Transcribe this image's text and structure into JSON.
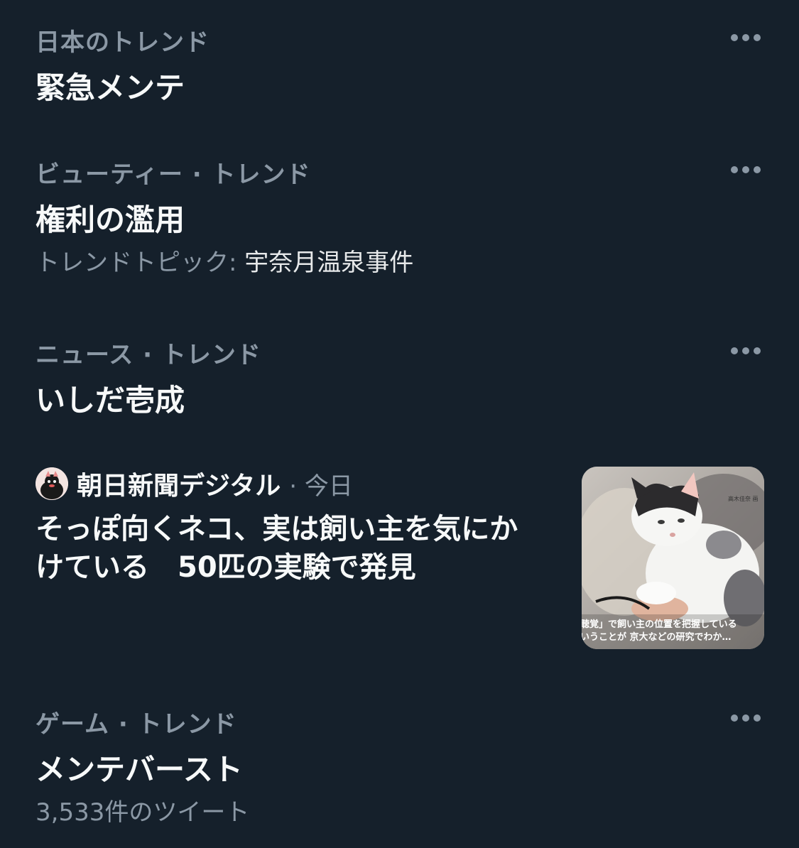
{
  "trends": [
    {
      "context": "日本のトレンド",
      "title": "緊急メンテ"
    },
    {
      "context": "ビューティー · トレンド",
      "title": "権利の濫用",
      "subtitle_prefix": "トレンドトピック: ",
      "subtitle_topic": "宇奈月温泉事件"
    },
    {
      "context": "ニュース · トレンド",
      "title": "いしだ壱成"
    },
    {
      "context": "ゲーム · トレンド",
      "title": "メンテバースト",
      "subtitle": "3,533件のツイート"
    }
  ],
  "news": {
    "source": "朝日新聞デジタル",
    "time": "· 今日",
    "headline_line1": "そっぽ向くネコ、実は飼い主を気にか",
    "headline_line2": "けている　50匹の実験で発見",
    "thumbnail_caption_line1": "聴覚」で飼い主の位置を把握している",
    "thumbnail_caption_line2": "いうことが 京大などの研究でわか…",
    "thumbnail_tag": "高木佳奈 画"
  },
  "icons": {
    "more": "more-horizontal-icon",
    "avatar": "asahi-avatar"
  },
  "colors": {
    "background": "#15202b",
    "primary_text": "#f7f9f9",
    "secondary_text": "#8b98a5"
  }
}
